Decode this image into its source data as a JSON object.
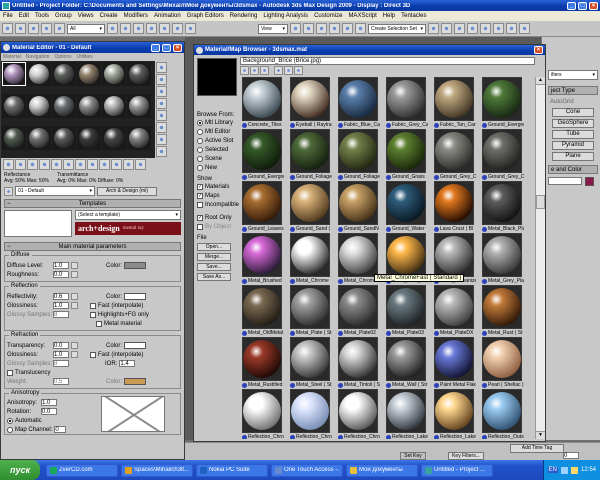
{
  "app": {
    "title": "Untitled - Project Folder: C:\\Documents and Settings\\Михаlл\\Мои документы\\3dsmax - Autodesk 3ds Max Design 2009 - Display : Direct 3D"
  },
  "menubar": [
    "File",
    "Edit",
    "Tools",
    "Group",
    "Views",
    "Create",
    "Modifiers",
    "Animation",
    "Graph Editors",
    "Rendering",
    "Lighting Analysis",
    "Customize",
    "MAXScript",
    "Help",
    "Tentacles"
  ],
  "toolbar": {
    "filter": "All",
    "view": "View",
    "selection_set": "Create Selection Set"
  },
  "material_editor": {
    "title": "Material Editor - 01 - Default",
    "menu": [
      "Material",
      "Navigation",
      "Options",
      "Utilities"
    ],
    "swatch_colors": [
      "#ad8fb8",
      "#cfcfcf",
      "#5c5f5c",
      "#8f7f6a",
      "#9fa89a",
      "#5b5b5b",
      "#6c6c6c",
      "#c7c7c7",
      "#6a6e72",
      "#8a8a8a",
      "#b0b0b0",
      "#949494",
      "#4f5a4f",
      "#6f6f6f",
      "#585858",
      "#3a3a3a",
      "#454545",
      "#808080"
    ],
    "stats": {
      "reflectance": "Reflectance",
      "avg_refl": "Avg: 50% Max: 50%",
      "transmittance": "Transmittance",
      "avg_trans": "Avg: 0% Max: 0% Diffuse: 0%"
    },
    "material_name": "01 - Default",
    "material_type": "Arch & Design (mi)",
    "templates": {
      "header": "Templates",
      "select": "(Select a template)",
      "brand": "arch+design",
      "brand_sub": "mental ray"
    },
    "params": {
      "header": "Main material parameters",
      "diffuse": {
        "label": "Diffuse",
        "level_label": "Diffuse Level:",
        "level": "1.0",
        "roughness_label": "Roughness:",
        "roughness": "0.0",
        "color_label": "Color:",
        "color": "#8a8a8a"
      },
      "reflection": {
        "label": "Reflection",
        "reflectivity_label": "Reflectivity:",
        "reflectivity": "0.6",
        "glossiness_label": "Glossiness:",
        "glossiness": "1.0",
        "samples_label": "Glossy Samples:",
        "samples": "8",
        "color_label": "Color:",
        "color": "#ffffff",
        "fast": "Fast (interpolate)",
        "highlights": "Highlights+FG only",
        "metal": "Metal material"
      },
      "refraction": {
        "label": "Refraction",
        "transparency_label": "Transparency:",
        "transparency": "0.0",
        "glossiness_label": "Glossiness:",
        "glossiness": "1.0",
        "samples_label": "Glossy Samples:",
        "samples": "8",
        "color_label": "Color:",
        "color": "#ffffff",
        "fast": "Fast (interpolate)",
        "ior_label": "IOR:",
        "ior": "1.4",
        "translucency": "Translucency",
        "weight_label": "Weight:",
        "weight": "0.5",
        "tcolor_label": "Color:",
        "tcolor": "#c89a54"
      },
      "anisotropy": {
        "label": "Anisotropy",
        "aniso_label": "Anisotropy:",
        "aniso": "1.0",
        "rotation_label": "Rotation:",
        "rotation": "0.0",
        "automatic": "Automatic",
        "map_channel": "Map Channel:",
        "channel": "0"
      }
    }
  },
  "browser": {
    "title": "Material/Map Browser - 3dsmax.mat",
    "path": "Background_Brice (Brice.jpg)",
    "browse_from": {
      "label": "Browse From:",
      "options": [
        "Mtl Library",
        "Mtl Editor",
        "Active Slot",
        "Selected",
        "Scene",
        "New"
      ],
      "selected": 0
    },
    "show": {
      "label": "Show",
      "options": [
        "Materials",
        "Maps",
        "Incompatible"
      ],
      "checked": [
        true,
        true,
        false
      ]
    },
    "root_only": "Root Only",
    "by_object": "By Object",
    "file": {
      "label": "File",
      "buttons": [
        "Open...",
        "Merge...",
        "Save...",
        "Save As..."
      ]
    },
    "tooltip": "Metal_ChromeFast ( Standard )",
    "rows": [
      [
        {
          "label": "Concrete_Tiles",
          "c": "#c9d2d8",
          "s": "#33414a"
        },
        {
          "label": "Eyeball ( Raytrac",
          "c": "#e0d6c0",
          "s": "#3b2418"
        },
        {
          "label": "Fabric_Blue_Car",
          "c": "#5a7faa",
          "s": "#15243a"
        },
        {
          "label": "Fabric_Grey_Car",
          "c": "#9a9a9a",
          "s": "#2c2c2c"
        },
        {
          "label": "Fabric_Tan_Carp",
          "c": "#c0a880",
          "s": "#3c3020"
        },
        {
          "label": "Ground_Evergre",
          "c": "#4f7a3a",
          "s": "#142210"
        }
      ],
      [
        {
          "label": "Ground_Evergree",
          "c": "#355a2a",
          "s": "#0c1808"
        },
        {
          "label": "Ground_Foliage",
          "c": "#4e6a3a",
          "s": "#121c0c"
        },
        {
          "label": "Ground_Foliage",
          "c": "#73814a",
          "s": "#1e220e"
        },
        {
          "label": "Ground_Grass",
          "c": "#5e8030",
          "s": "#152208"
        },
        {
          "label": "Ground_Grey_Di",
          "c": "#8c8c86",
          "s": "#262624"
        },
        {
          "label": "Ground_Grey_Di",
          "c": "#6f6f6a",
          "s": "#1c1c1a"
        }
      ],
      [
        {
          "label": "Ground_Leaves",
          "c": "#a86e30",
          "s": "#2e1606"
        },
        {
          "label": "Ground_Sand (",
          "c": "#d8b27a",
          "s": "#4a3418"
        },
        {
          "label": "Ground_SandN",
          "c": "#c8a066",
          "s": "#3e2c14"
        },
        {
          "label": "Ground_Water",
          "c": "#2e5d7a",
          "s": "#06141e"
        },
        {
          "label": "Lava Crust ( Bl",
          "c": "#e0781e",
          "s": "#1a0600"
        },
        {
          "label": "Metal_Black_Pla",
          "c": "#5c5c5c",
          "s": "#0e0e0e"
        }
      ],
      [
        {
          "label": "Metal_Brushed",
          "c": "#d86ad8",
          "s": "#221830"
        },
        {
          "label": "Metal_Chrome",
          "c": "#ffffff",
          "s": "#202020"
        },
        {
          "label": "Metal_Chrome",
          "c": "#e0e0e0",
          "s": "#3a3a3a"
        },
        {
          "label": "Metal_Dark_Bru",
          "c": "#ffb84a",
          "s": "#3a2810"
        },
        {
          "label": "Metal_Galvanize",
          "c": "#b6b6b6",
          "s": "#2a2a2a"
        },
        {
          "label": "Metal_Grey_Pla",
          "c": "#b0b0b0",
          "s": "#333333"
        }
      ],
      [
        {
          "label": "Metal_OldMetal",
          "c": "#7a6a52",
          "s": "#1e1810"
        },
        {
          "label": "Metal_Plate ( St",
          "c": "#a0a0a0",
          "s": "#262626"
        },
        {
          "label": "Metal_Plate02",
          "c": "#8a8a8a",
          "s": "#242424"
        },
        {
          "label": "Metal_Plate03",
          "c": "#6a7a80",
          "s": "#1a1e20"
        },
        {
          "label": "Metal_PlateDX",
          "c": "#b8b8b8",
          "s": "#3a3a3a"
        },
        {
          "label": "Metal_Rust ( St",
          "c": "#c27a3a",
          "s": "#2a1406"
        }
      ],
      [
        {
          "label": "Metal_Rustified",
          "c": "#9a3a28",
          "s": "#1a0604"
        },
        {
          "label": "Metal_Steel ( St",
          "c": "#c8c8c8",
          "s": "#2e2e2e"
        },
        {
          "label": "Metal_Tintoil ( S",
          "c": "#d8d8d8",
          "s": "#2a2a2a"
        },
        {
          "label": "Metal_Wall ( Str",
          "c": "#9a9a9a",
          "s": "#1a1a1a"
        },
        {
          "label": "Paint Metal Flake",
          "c": "#6a7ad8",
          "s": "#0c0e2a"
        },
        {
          "label": "Pearl ( Shellac )",
          "c": "#f0d0b0",
          "s": "#8a5a3a"
        }
      ],
      [
        {
          "label": "Reflection_Chro",
          "c": "#ffffff",
          "s": "#6a6a6a"
        },
        {
          "label": "Reflection_Chro",
          "c": "#e0e8ff",
          "s": "#7088b0"
        },
        {
          "label": "Reflection_Chro",
          "c": "#ffffff",
          "s": "#505050"
        },
        {
          "label": "Reflection_Lake",
          "c": "#c8d0d8",
          "s": "#2a3038"
        },
        {
          "label": "Reflection_Lake",
          "c": "#ffd890",
          "s": "#5a3a18"
        },
        {
          "label": "Reflection_Outsi",
          "c": "#9acaf0",
          "s": "#2a4a6a"
        }
      ]
    ]
  },
  "command_panel": {
    "dropdown": "ifiers",
    "rollout": "ject Type",
    "autogrid": "AutoGrid",
    "buttons": [
      "Cone",
      "GeoSphere",
      "Tube",
      "Pyramid",
      "Plane"
    ],
    "color_label": "e and Color",
    "color": "#8a1a4a"
  },
  "status": {
    "add_time_tag": "Add Time Tag",
    "set_key": "Set Key",
    "key_filters": "Key Filters...",
    "frame": "0"
  },
  "taskbar": {
    "start": "пуск",
    "items": [
      {
        "label": "ZverCD.com",
        "c": "#1aa85a"
      },
      {
        "label": "Spaces\\Mihailch3lt...",
        "c": "#e0a020"
      },
      {
        "label": "Nokia PC Suite",
        "c": "#2060c0"
      },
      {
        "label": "One Touch Access -...",
        "c": "#6a8ad0"
      },
      {
        "label": "Мои документы",
        "c": "#e8c040"
      },
      {
        "label": "Untitled - Project ...",
        "c": "#3aa0a0"
      }
    ],
    "lang": "EN",
    "clock": "12:54"
  }
}
